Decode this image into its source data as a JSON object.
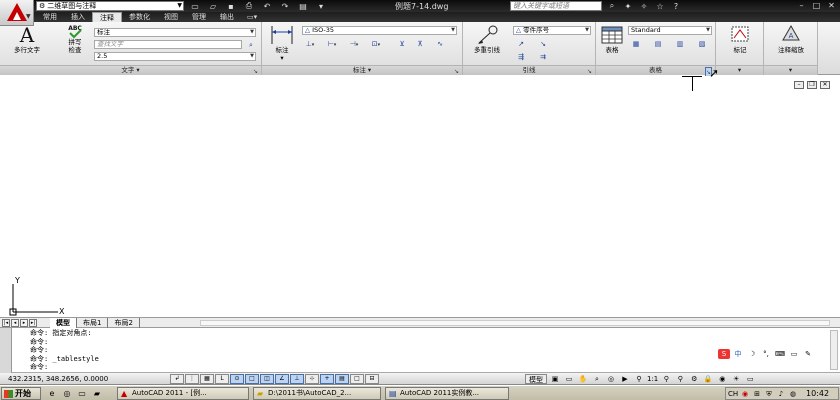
{
  "window": {
    "workspace": "二维草图与注释",
    "doc_title": "例题7-14.dwg",
    "search_placeholder": "键入关键字或短语",
    "quick_access": [
      "new",
      "open",
      "save",
      "plot",
      "undo",
      "redo"
    ]
  },
  "ribbon_tabs": [
    "常用",
    "插入",
    "注释",
    "参数化",
    "视图",
    "管理",
    "输出"
  ],
  "active_tab": "注释",
  "panels": {
    "text": {
      "title": "文字",
      "mtext_label": "多行文字",
      "spell_label_1": "拼写",
      "spell_label_2": "检查",
      "style_value": "标注",
      "find_placeholder": "查找文字",
      "height_value": "2.5"
    },
    "dim": {
      "title": "标注",
      "dim_label": "标注",
      "style_value": "ISO-35"
    },
    "leader": {
      "title": "引线",
      "mleader_label": "多重引线",
      "style_value": "零件序号"
    },
    "table": {
      "title": "表格",
      "table_label": "表格",
      "style_value": "Standard"
    },
    "markup": {
      "title": "",
      "label": "标记"
    },
    "scale": {
      "title": "",
      "label": "注释缩放"
    }
  },
  "layout_tabs": [
    "模型",
    "布局1",
    "布局2"
  ],
  "active_layout": "模型",
  "command_lines": [
    "命令: 指定对角点:",
    "命令:",
    "命令:",
    "命令: _tablestyle",
    "命令:"
  ],
  "status": {
    "coords": "432.2315,  348.2656, 0.0000",
    "model_label": "模型",
    "anno_scale": "1:1"
  },
  "taskbar": {
    "start_label": "开始",
    "tasks": [
      "AutoCAD 2011 - [例...",
      "D:\\2011书\\AutoCAD_2...",
      "AutoCAD 2011实例教..."
    ],
    "clock": "10:42"
  },
  "colors": {
    "titlebar": "#1a1a1a",
    "ribbon": "#e8e8e8",
    "drawing_bg": "#ffffff",
    "accent_red": "#c40000"
  }
}
